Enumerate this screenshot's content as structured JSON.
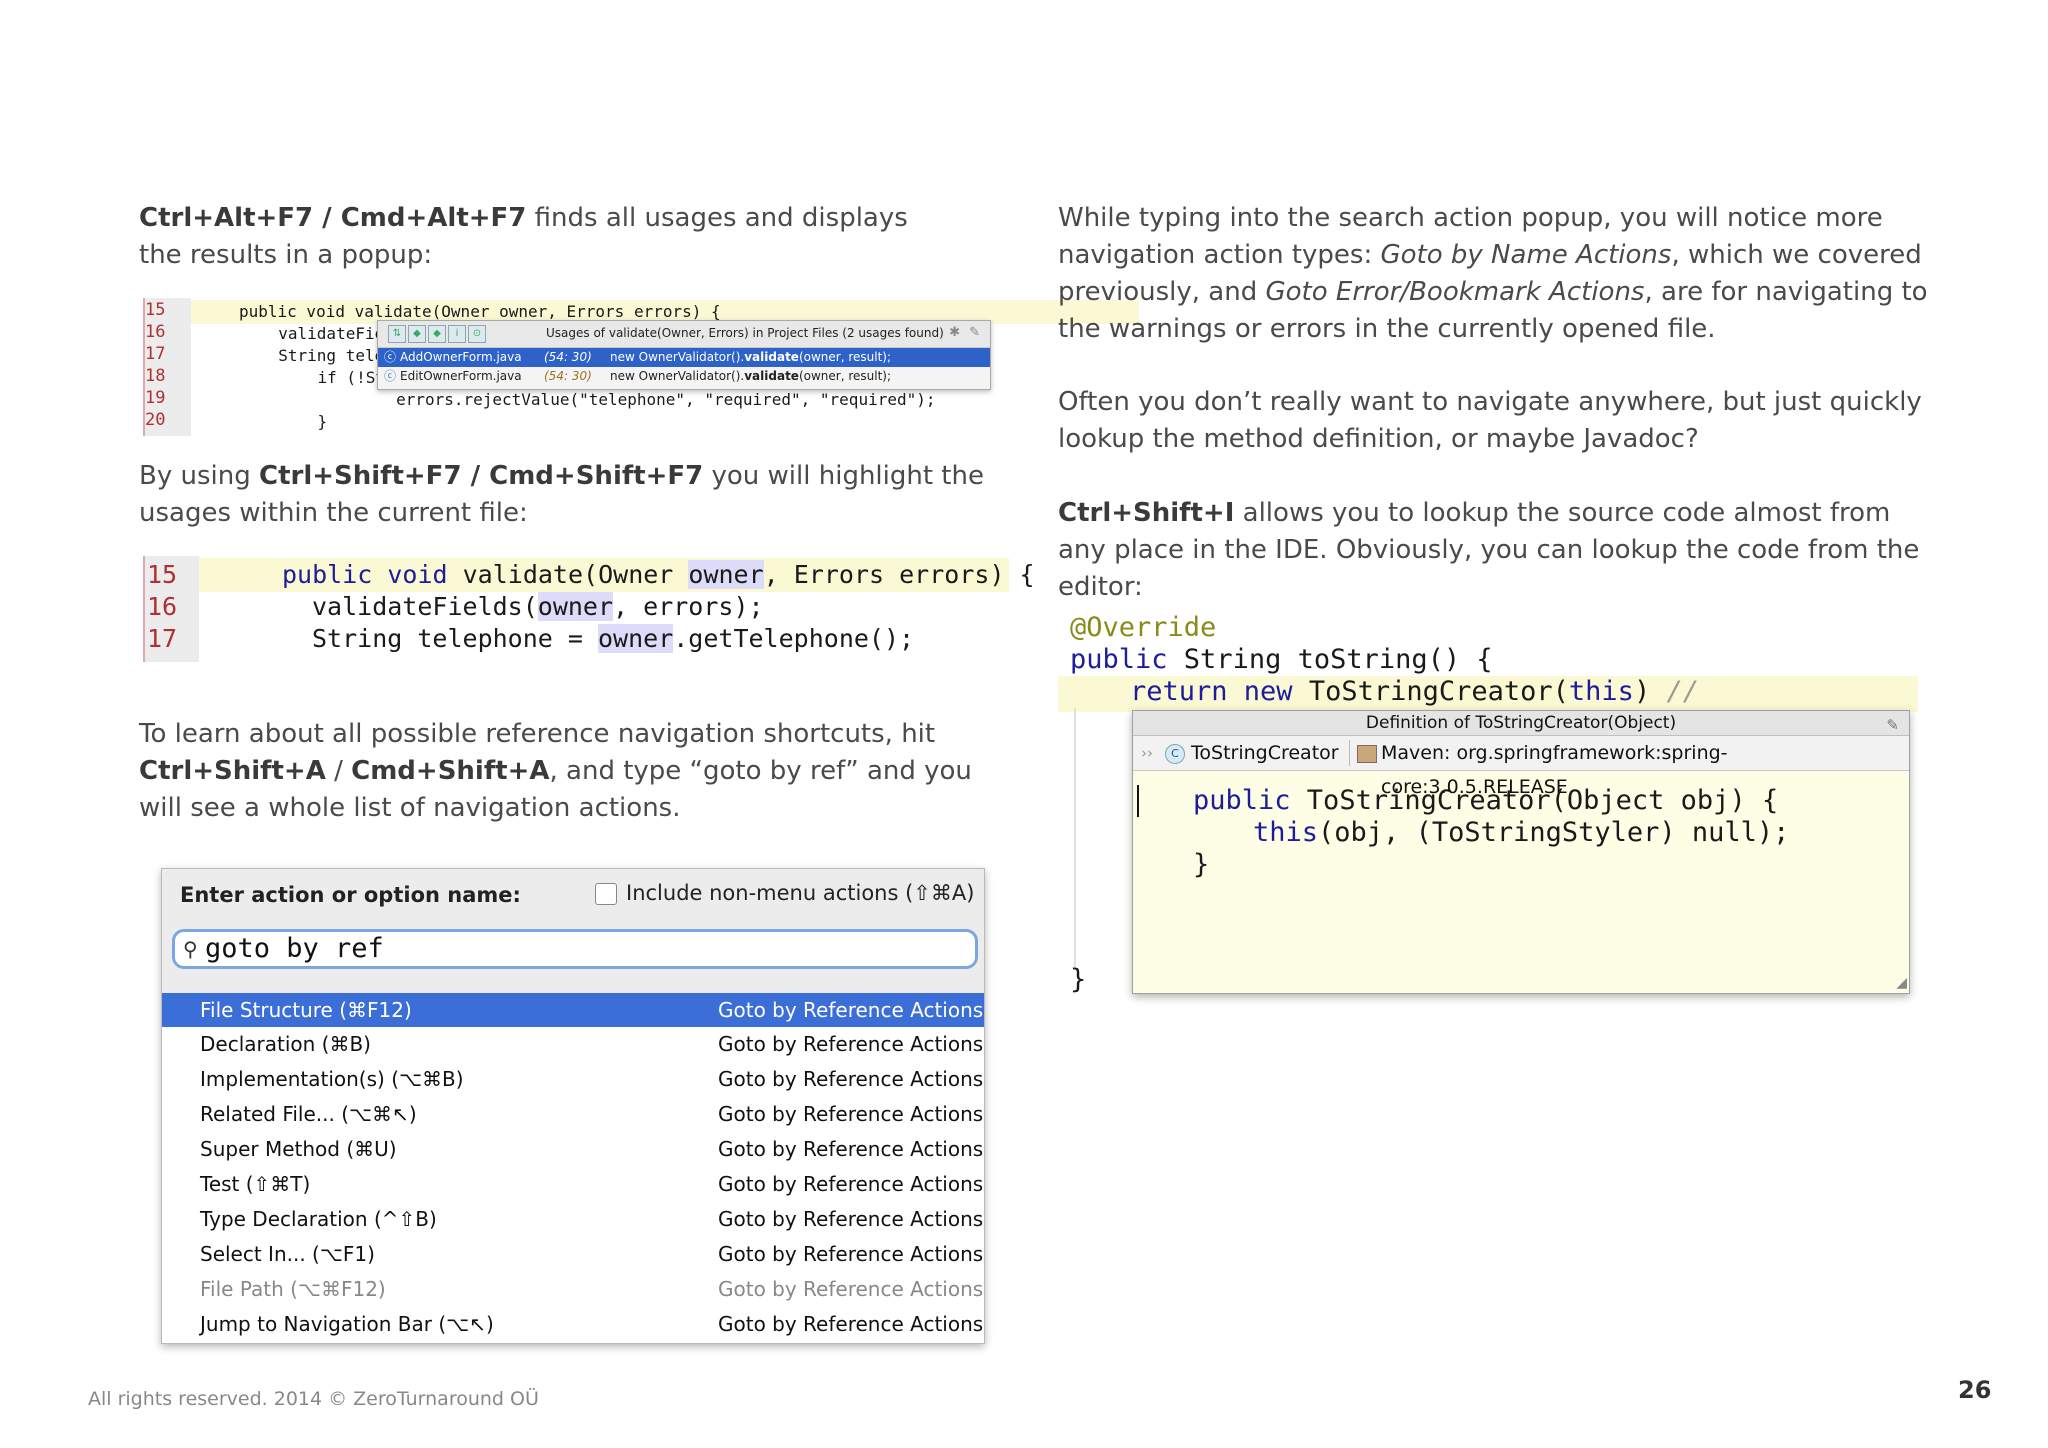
{
  "left_column": {
    "p1_bold": "Ctrl+Alt+F7 / Cmd+Alt+F7",
    "p1_rest": " finds all usages and displays the results in a popup:",
    "p2_pre": "By using ",
    "p2_bold": "Ctrl+Shift+F7 / Cmd+Shift+F7",
    "p2_rest": " you will highlight the usages within the current file:",
    "p3_pre": "To learn about all possible reference navigation shortcuts, hit ",
    "p3_bold1": "Ctrl+Shift+A",
    "p3_mid": " / ",
    "p3_bold2": "Cmd+Shift+A",
    "p3_rest": ", and type “goto by ref” and you will see a whole list of navigation actions."
  },
  "right_column": {
    "p1_pre": "While typing into the search action popup, you will notice more navigation action types: ",
    "p1_it1": "Goto by Name Actions",
    "p1_mid": ", which we covered previously, and ",
    "p1_it2": "Goto Error/Bookmark Actions",
    "p1_rest": ", are for navigating to the warnings or errors in the currently opened file.",
    "p2": "Often you don’t really want to navigate anywhere, but just quickly lookup the method definition, or maybe Javadoc?",
    "p3_bold": "Ctrl+Shift+I",
    "p3_rest": " allows you to lookup the source code almost from any place in the IDE. Obviously, you can lookup the code from the editor:"
  },
  "usages_screenshot": {
    "line_numbers": [
      "15",
      "16",
      "17",
      "18",
      "19",
      "20"
    ],
    "code_lines": [
      "public void validate(Owner owner, Errors errors) {",
      "  validateFie",
      "  String tele",
      "    if (!Stri",
      "        errors.rejectValue(\"telephone\", \"required\", \"required\");",
      "    }"
    ],
    "popup_title": "Usages of validate(Owner, Errors) in Project Files (2 usages found)",
    "rows": [
      {
        "file": "AddOwnerForm.java",
        "pos": "(54: 30)",
        "code_pre": "new OwnerValidator().",
        "code_bold": "validate",
        "code_post": "(owner, result);"
      },
      {
        "file": "EditOwnerForm.java",
        "pos": "(54: 30)",
        "code_pre": "new OwnerValidator().",
        "code_bold": "validate",
        "code_post": "(owner, result);"
      }
    ]
  },
  "highlight_screenshot": {
    "line_numbers": [
      "15",
      "16",
      "17"
    ],
    "line1": {
      "kw": "public void",
      "a": " validate(Owner ",
      "usage": "owner",
      "b": ", Errors errors) {"
    },
    "line2": {
      "a": "validateFields(",
      "usage": "owner",
      "b": ", errors);"
    },
    "line3": {
      "a": "String telephone = ",
      "usage": "owner",
      "b": ".getTelephone();"
    }
  },
  "action_popup": {
    "label": "Enter action or option name:",
    "checkbox_label": "Include non-menu actions (⇧⌘A)",
    "input_value": "goto by ref",
    "rows": [
      {
        "name": "File Structure (⌘F12)",
        "group": "Goto by Reference Actions"
      },
      {
        "name": "Declaration (⌘B)",
        "group": "Goto by Reference Actions"
      },
      {
        "name": "Implementation(s) (⌥⌘B)",
        "group": "Goto by Reference Actions"
      },
      {
        "name": "Related File... (⌥⌘↖)",
        "group": "Goto by Reference Actions"
      },
      {
        "name": "Super Method (⌘U)",
        "group": "Goto by Reference Actions"
      },
      {
        "name": "Test (⇧⌘T)",
        "group": "Goto by Reference Actions"
      },
      {
        "name": "Type Declaration (^⇧B)",
        "group": "Goto by Reference Actions"
      },
      {
        "name": "Select In... (⌥F1)",
        "group": "Goto by Reference Actions"
      },
      {
        "name": "File Path (⌥⌘F12)",
        "group": "Goto by Reference Actions"
      },
      {
        "name": "Jump to Navigation Bar (⌥↖)",
        "group": "Goto by Reference Actions"
      }
    ]
  },
  "definition_screenshot": {
    "annotation": "@Override",
    "line2_kw": "public",
    "line2_rest": " String toString() {",
    "line3_kw": "return new",
    "line3_mid": " ToStringCreator(",
    "line3_this": "this",
    "line3_end": ") ",
    "line3_comment": "//",
    "closing_brace": "}",
    "popup_title": "Definition of ToStringCreator(Object)",
    "class_name": "ToStringCreator",
    "maven": "Maven: org.springframework:spring-core:3.0.5.RELEASE",
    "def_line1_kw": "public",
    "def_line1_rest": " ToStringCreator(Object obj) {",
    "def_line2_kw": "this",
    "def_line2_rest": "(obj, (ToStringStyler) null);",
    "def_line3": "}"
  },
  "footer": {
    "rights": "All rights reserved. 2014 © ZeroTurnaround OÜ",
    "page": "26"
  }
}
